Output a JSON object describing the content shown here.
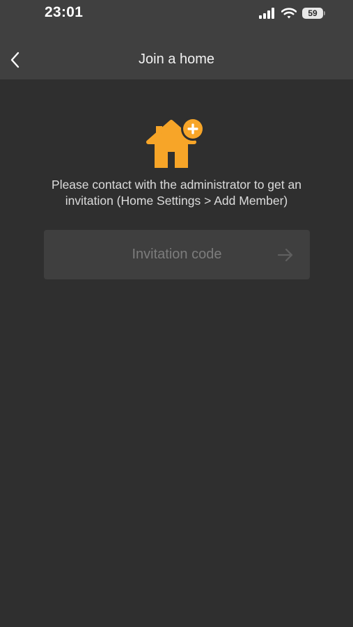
{
  "status_bar": {
    "time": "23:01",
    "battery": "59",
    "icons": [
      "signal-icon",
      "wifi-icon",
      "battery-icon"
    ]
  },
  "nav": {
    "title": "Join a home",
    "back_icon": "chevron-left-icon"
  },
  "content": {
    "illustration_icon": "home-add-icon",
    "instruction_line1": "Please contact with the administrator to get an",
    "instruction_line2": "invitation (Home Settings > Add Member)",
    "code_input": {
      "value": "",
      "placeholder": "Invitation code"
    },
    "submit_icon": "arrow-right-icon"
  },
  "colors": {
    "accent": "#f7a528",
    "background": "#2f2f2f",
    "header": "#404040",
    "field": "#3f3f3f"
  }
}
